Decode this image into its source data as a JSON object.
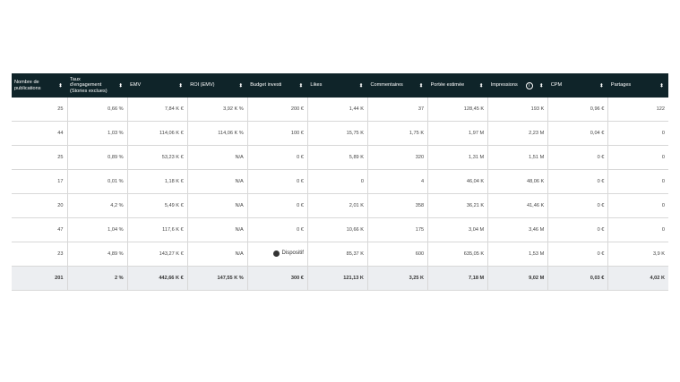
{
  "columns": [
    "Nombre de publications",
    "Taux d'engagement (Stories exclues)",
    "EMV",
    "ROI (EMV)",
    "Budget investi",
    "Likes",
    "Commentaires",
    "Portée estimée",
    "Impressions",
    "CPM",
    "Partages"
  ],
  "rows": [
    [
      "25",
      "0,66 %",
      "7,84 K €",
      "3,92 K %",
      "200 €",
      "1,44 K",
      "37",
      "128,45 K",
      "193 K",
      "0,96 €",
      "122"
    ],
    [
      "44",
      "1,03 %",
      "114,06 K €",
      "114,06 K %",
      "100 €",
      "15,75 K",
      "1,75 K",
      "1,97 M",
      "2,23 M",
      "0,04 €",
      "0"
    ],
    [
      "25",
      "0,89 %",
      "53,23 K €",
      "N/A",
      "0 €",
      "5,89 K",
      "320",
      "1,31 M",
      "1,51 M",
      "0 €",
      "0"
    ],
    [
      "17",
      "0,01 %",
      "1,18 K €",
      "N/A",
      "0 €",
      "0",
      "4",
      "46,04 K",
      "48,06 K",
      "0 €",
      "0"
    ],
    [
      "20",
      "4,2 %",
      "5,49 K €",
      "N/A",
      "0 €",
      "2,01 K",
      "358",
      "36,21 K",
      "41,46 K",
      "0 €",
      "0"
    ],
    [
      "47",
      "1,04 %",
      "117,6 K €",
      "N/A",
      "0 €",
      "10,66 K",
      "175",
      "3,04 M",
      "3,46 M",
      "0 €",
      "0"
    ],
    [
      "23",
      "4,89 %",
      "143,27 K €",
      "N/A",
      "Dispositif",
      "85,37 K",
      "600",
      "635,05 K",
      "1,53 M",
      "0 €",
      "3,9 K"
    ]
  ],
  "total": [
    "201",
    "2 %",
    "442,66 K €",
    "147,55 K %",
    "300 €",
    "121,13 K",
    "3,25 K",
    "7,18 M",
    "9,02 M",
    "0,03 €",
    "4,02 K"
  ],
  "info_icon": "i"
}
